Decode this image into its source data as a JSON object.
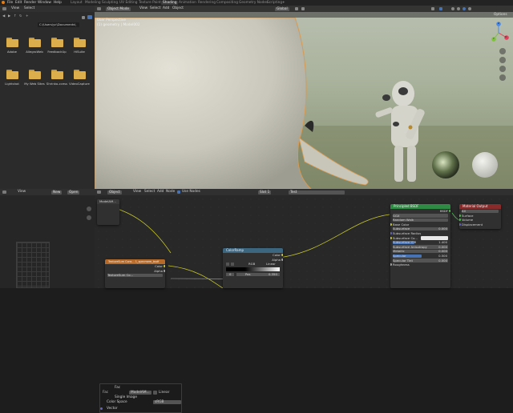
{
  "topbar": {
    "menus": [
      "File",
      "Edit",
      "Render",
      "Window",
      "Help"
    ],
    "workspaces": [
      "Layout",
      "Modeling",
      "Sculpting",
      "UV Editing",
      "Texture Paint",
      "Shading",
      "Animation",
      "Rendering",
      "Compositing",
      "Geometry Nodes",
      "Scripting"
    ],
    "active_workspace": "Shading"
  },
  "file_browser": {
    "header": [
      "View",
      "Select"
    ],
    "path": "C:\\Users\\yc\\Documents\\",
    "folders": [
      "Adobe",
      "AllegroWeb",
      "FeedbackUp",
      "HiSuite",
      "Lightshot",
      "My Web Sites",
      "Shrinko-ccess",
      "VideoCapture"
    ],
    "folder_color": "#dcae4c"
  },
  "viewport": {
    "mode": "Object Mode",
    "menus": [
      "View",
      "Select",
      "Add",
      "Object"
    ],
    "view_name": "User Perspective",
    "object_name": "(1) geometry | Model002",
    "orientation": "Global",
    "options_label": "Options",
    "gizmo_axes": [
      "X",
      "Y",
      "Z"
    ]
  },
  "node_editor": {
    "left_header": [
      "View",
      "New",
      "Open"
    ],
    "header_menus": [
      "Object",
      "View",
      "Select",
      "Add",
      "Node"
    ],
    "use_nodes_label": "Use Nodes",
    "slot": "Slot 1",
    "material": "Test",
    "popup": {
      "title": "Fac",
      "items": [
        "Fac",
        "Single Image",
        "Color Space",
        "Vector"
      ],
      "image_name": "ModelAM...",
      "color_space": "sRGB",
      "source": "Linear"
    },
    "nodes": {
      "bsdf": {
        "title": "Principled BSDF",
        "output": "BSDF",
        "rows": [
          "GGX",
          "Random Walk",
          "Base Color",
          "Subsurface",
          "Subsurface Radius",
          "Subsurface Co...",
          "Subsurface IOR",
          "Subsurface Anisotropy",
          "Metallic",
          "Specular",
          "Specular Tint",
          "Roughness"
        ],
        "values": {
          "Subsurface": "0.000",
          "Subsurface IOR": "1.400",
          "Subsurface Anisotropy": "0.000",
          "Metallic": "0.000",
          "Specular": "0.500",
          "Specular Tint": "0.000"
        }
      },
      "material_output": {
        "title": "Material Output",
        "target": "All",
        "rows": [
          "Surface",
          "Volume",
          "Displacement"
        ]
      },
      "color_ramp": {
        "title": "ColorRamp",
        "outputs": [
          "Color",
          "Alpha"
        ],
        "mode": "RGB",
        "interpolation": "Linear",
        "pos_label": "Pos",
        "pos_value": "0.350",
        "index": "0"
      },
      "texture_a": {
        "title": "TextureSum Cons... 1_specmem_bsdf",
        "outputs": [
          "Color",
          "Alpha"
        ],
        "image": "TextureSum Co..."
      },
      "image_tex": {
        "title": "ModelAM...",
        "label": "Model"
      }
    }
  }
}
